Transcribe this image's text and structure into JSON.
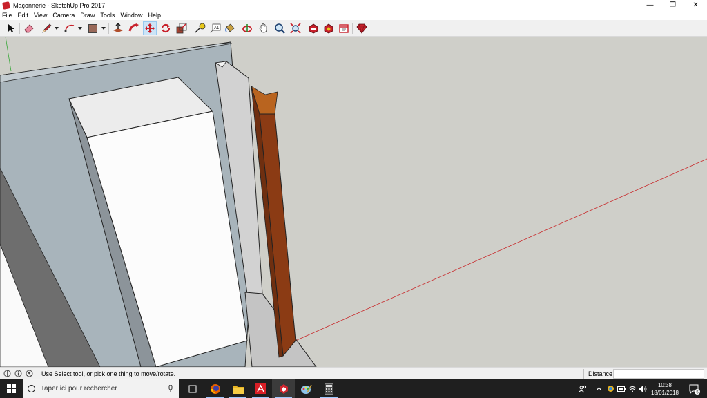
{
  "window": {
    "title": "Maçonnerie - SketchUp Pro 2017",
    "minimize_glyph": "—",
    "maximize_glyph": "❐",
    "close_glyph": "✕"
  },
  "menu": [
    "File",
    "Edit",
    "View",
    "Camera",
    "Draw",
    "Tools",
    "Window",
    "Help"
  ],
  "toolbar": {
    "tools": [
      "select-icon",
      "eraser-icon",
      "pencil-line-icon",
      "arc-icon",
      "rectangle-icon",
      "push-pull-icon",
      "follow-me-icon",
      "move-icon",
      "rotate-icon",
      "scale-icon",
      "tape-measure-icon",
      "text-icon",
      "paint-bucket-icon",
      "orbit-icon",
      "pan-icon",
      "zoom-icon",
      "zoom-extents-icon",
      "3d-warehouse-icon",
      "extension-warehouse-icon",
      "layout-icon",
      "ruby-icon"
    ],
    "active_tool": "move-icon",
    "text_tool_glyph": "A1"
  },
  "colors": {
    "red_axis": "#c8282a",
    "green_axis": "#3aa83a",
    "viewport_bg": "#cfcfc9",
    "wall": "#a8b4bb",
    "wood": "#8b3b14",
    "wood_top": "#b9641f"
  },
  "statusbar": {
    "hint": "Use Select tool, or pick one thing to move/rotate.",
    "distance_label": "Distance",
    "distance_value": ""
  },
  "taskbar": {
    "search_placeholder": "Taper ici pour rechercher",
    "apps": [
      "task-view-icon",
      "firefox-icon",
      "file-explorer-icon",
      "acrobat-icon",
      "sketchup-icon",
      "paint-icon",
      "calculator-icon"
    ],
    "time": "10:38",
    "date": "18/01/2018",
    "notification_count": "5"
  }
}
